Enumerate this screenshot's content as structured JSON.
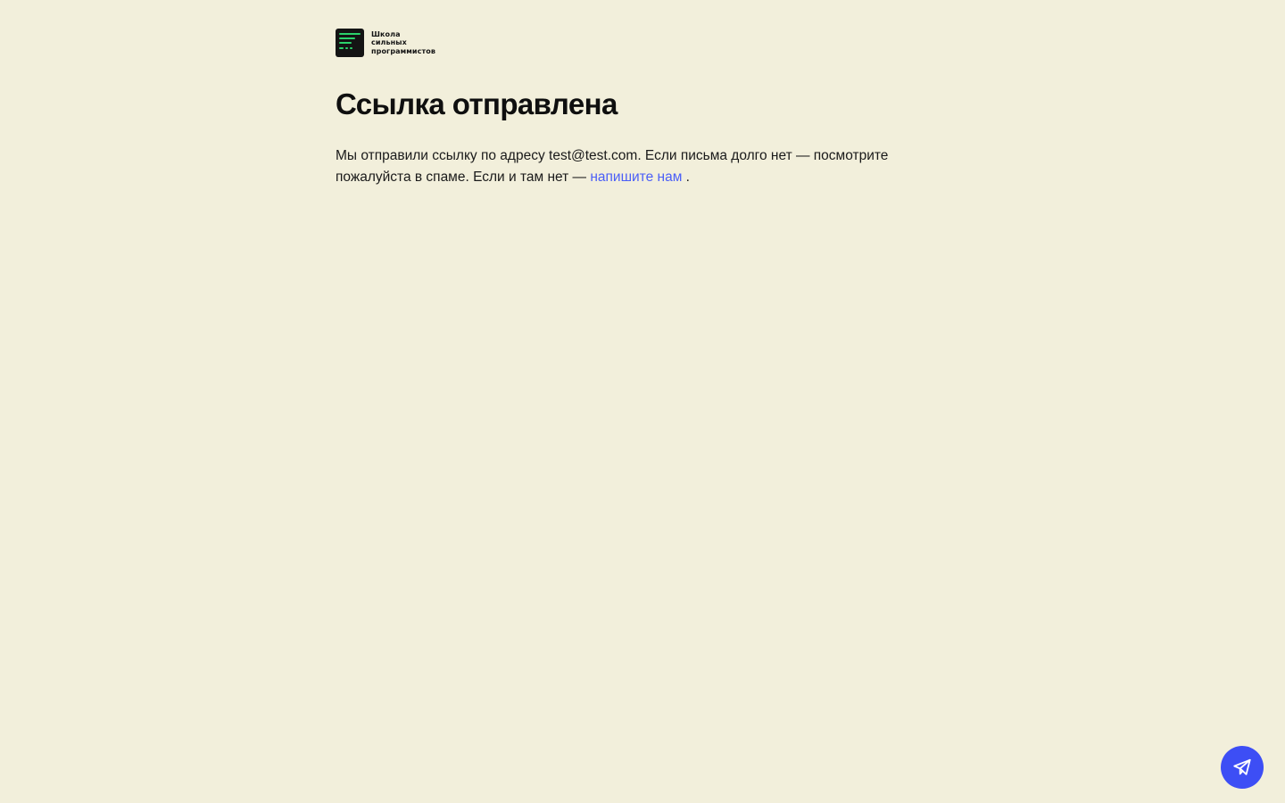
{
  "logo": {
    "line1": "Школа",
    "line2": "сильных",
    "line3": "программистов"
  },
  "page_title": "Ссылка отправлена",
  "message": {
    "part1": "Мы отправили ссылку по адресу ",
    "email": "test@test.com",
    "part2": ". Если письма долго нет — посмотрите пожалуйста в спаме. Если и там нет — ",
    "link_text": "напишите нам",
    "part3": " ."
  },
  "support_button": {
    "icon": "paper-plane-icon"
  },
  "colors": {
    "background": "#f2efdb",
    "link": "#4a5ef7",
    "fab": "#3d4ef5",
    "logo_accent": "#2bd26b"
  }
}
